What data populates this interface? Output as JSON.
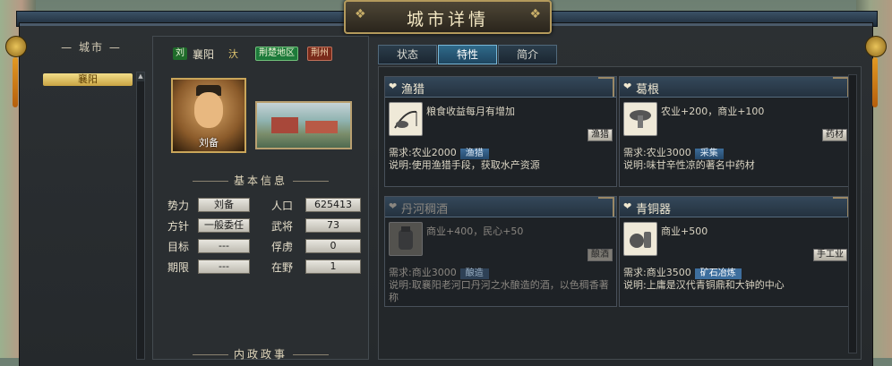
{
  "window": {
    "title": "城市详情"
  },
  "sidebar": {
    "header": "城市",
    "selected": "襄阳"
  },
  "city": {
    "ruler_chip": "刘",
    "name": "襄阳",
    "mark": "汏",
    "region": "荆楚地区",
    "province": "荆州",
    "governor_name": "刘备"
  },
  "info": {
    "section_title": "基本信息",
    "section2_title": "内政政事",
    "rows": [
      {
        "label": "势力",
        "value": "刘备",
        "label2": "人口",
        "value2": "625413"
      },
      {
        "label": "方针",
        "value": "一般委任",
        "label2": "武将",
        "value2": "73"
      },
      {
        "label": "目标",
        "value": "---",
        "label2": "俘虏",
        "value2": "0"
      },
      {
        "label": "期限",
        "value": "---",
        "label2": "在野",
        "value2": "1"
      }
    ]
  },
  "tabs": [
    {
      "label": "状态",
      "active": false
    },
    {
      "label": "特性",
      "active": true
    },
    {
      "label": "简介",
      "active": false
    }
  ],
  "traits": [
    {
      "title": "渔猎",
      "icon": "fishing-icon",
      "desc": "粮食收益每月有增加",
      "tag": "渔猎",
      "need_label": "需求:农业2000",
      "need_tag": "渔猎",
      "explain": "说明:使用渔猎手段，获取水产资源",
      "active": true
    },
    {
      "title": "葛根",
      "icon": "mushroom-herb-icon",
      "desc": "农业+200，商业+100",
      "tag": "药材",
      "need_label": "需求:农业3000",
      "need_tag": "采集",
      "explain": "说明:味甘辛性凉的著名中药材",
      "active": true
    },
    {
      "title": "丹河稠酒",
      "icon": "wine-jar-icon",
      "desc": "商业+400，民心+50",
      "tag": "酿酒",
      "need_label": "需求:商业3000",
      "need_tag": "酿造",
      "explain": "说明:取襄阳老河口丹河之水酿造的酒，以色稠香著称",
      "active": false
    },
    {
      "title": "青铜器",
      "icon": "bronze-vessel-icon",
      "desc": "商业+500",
      "tag": "手工业",
      "need_label": "需求:商业3500",
      "need_tag": "矿石冶炼",
      "explain": "说明:上庸是汉代青铜鼎和大钟的中心",
      "active": true
    }
  ]
}
